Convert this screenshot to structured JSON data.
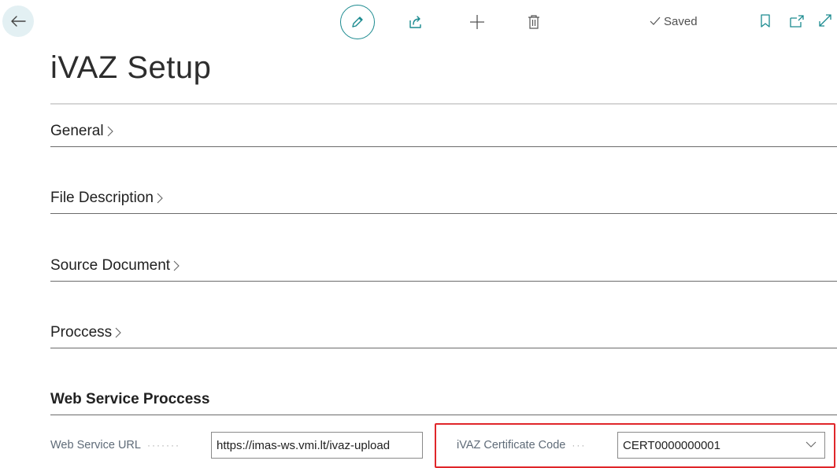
{
  "toolbar": {
    "saved_label": "Saved"
  },
  "page": {
    "title": "iVAZ Setup"
  },
  "sections": {
    "general": "General",
    "file_description": "File Description",
    "source_document": "Source Document",
    "process": "Proccess",
    "web_service_process": "Web Service Proccess"
  },
  "fields": {
    "web_service_url": {
      "label": "Web Service URL",
      "value": "https://imas-ws.vmi.lt/ivaz-upload"
    },
    "certificate_code": {
      "label": "iVAZ Certificate Code",
      "value": "CERT0000000001"
    }
  },
  "colors": {
    "accent": "#1a8a8f",
    "highlight": "#e0262a",
    "back_button_bg": "#e3f0f3"
  }
}
